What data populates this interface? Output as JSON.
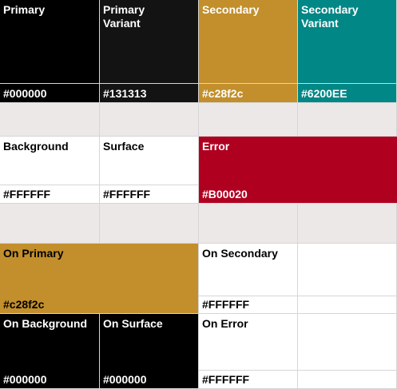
{
  "row1": [
    {
      "label": "Primary",
      "hex": "#000000",
      "color": "#000000"
    },
    {
      "label": "Primary\nVariant",
      "hex": "#131313",
      "color": "#131313"
    },
    {
      "label": "Secondary",
      "hex": "#c28f2c",
      "color": "#c28f2c"
    },
    {
      "label": "Secondary\nVariant",
      "hex": "#6200EE",
      "color": "#018786"
    }
  ],
  "row2": [
    {
      "label": "Background",
      "hex": "#FFFFFF",
      "color": "#ffffff"
    },
    {
      "label": "Surface",
      "hex": "#FFFFFF",
      "color": "#ffffff"
    },
    {
      "label": "Error",
      "hex": "#B00020",
      "color": "#b00020"
    }
  ],
  "row3": [
    {
      "label": "On Primary",
      "hex": "#c28f2c",
      "color": "#c28f2c"
    },
    {
      "label": "On Secondary",
      "hex": "#FFFFFF",
      "color": "#ffffff"
    }
  ],
  "row4": [
    {
      "label": "On Background",
      "hex": "#000000",
      "color": "#000000"
    },
    {
      "label": "On Surface",
      "hex": "#000000",
      "color": "#000000"
    },
    {
      "label": "On Error",
      "hex": "#FFFFFF",
      "color": "#ffffff"
    }
  ],
  "spacer_color": "#ece8e7"
}
